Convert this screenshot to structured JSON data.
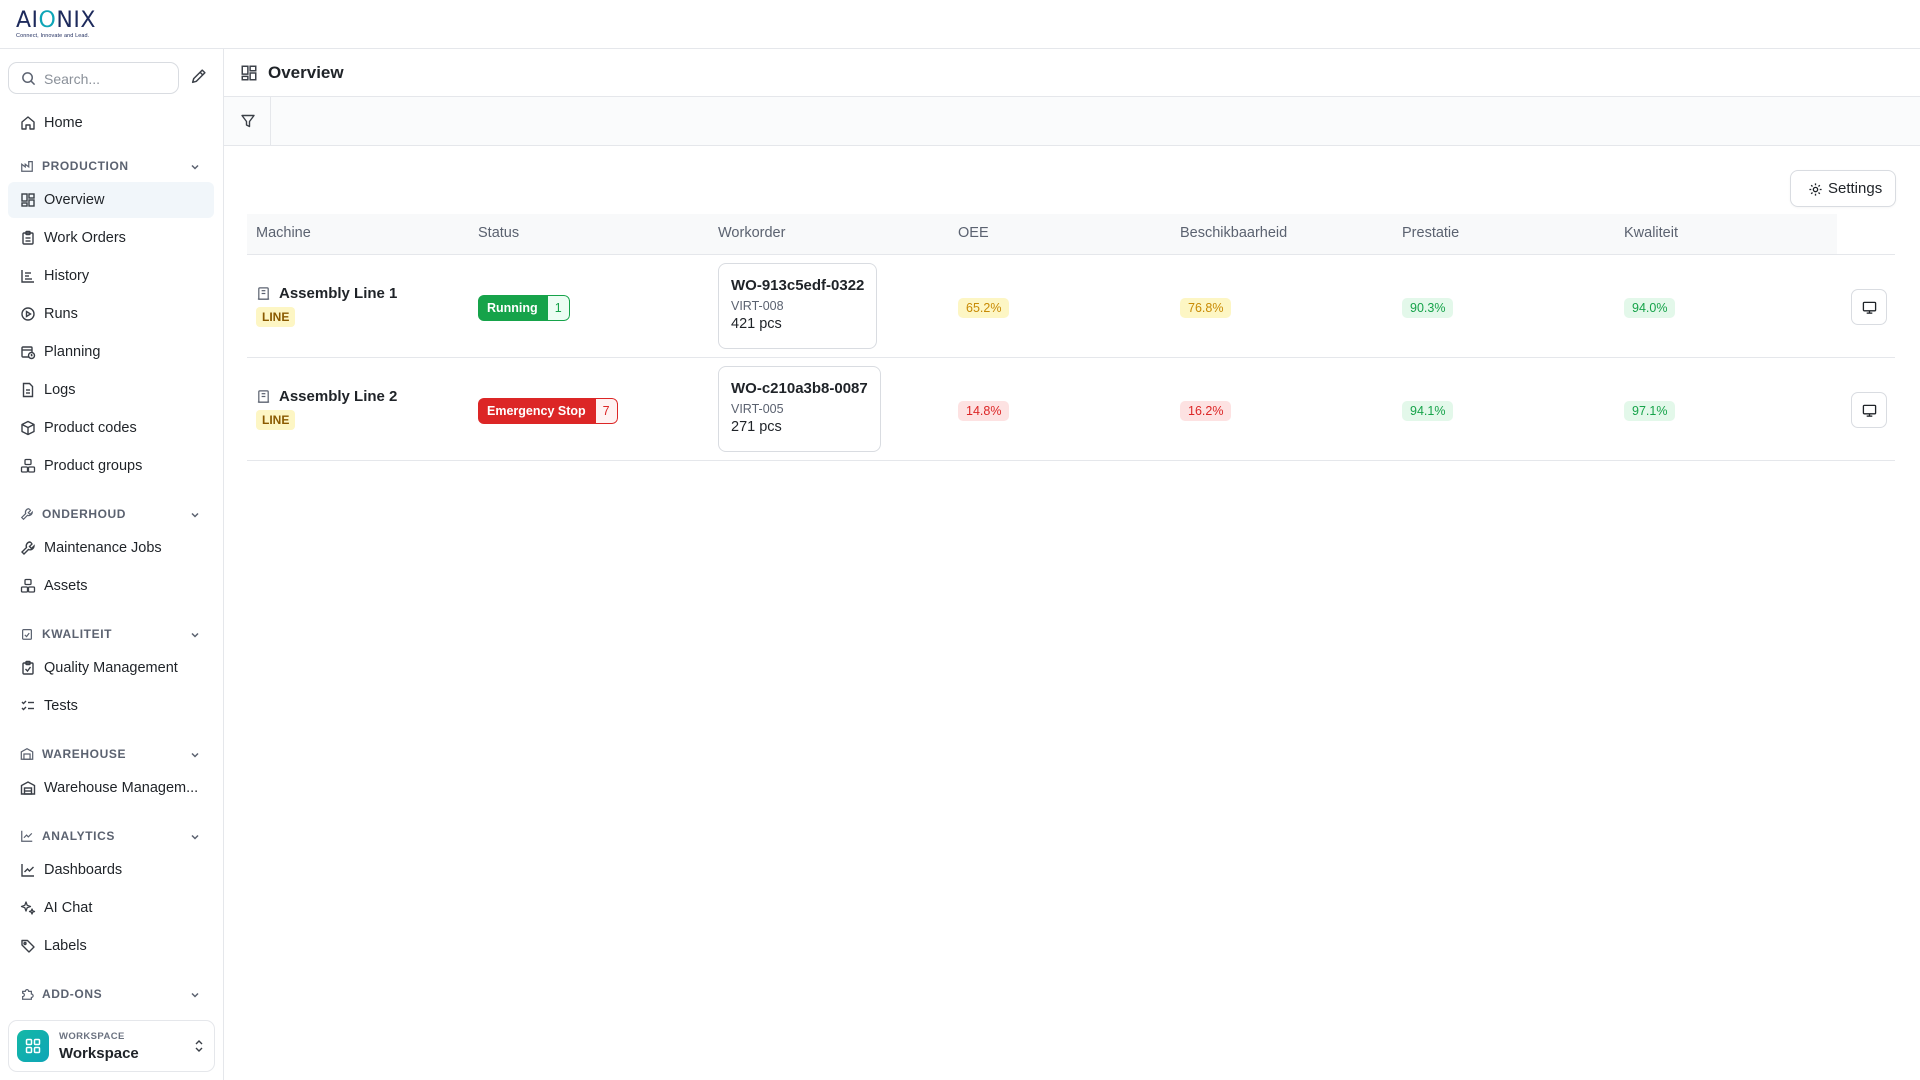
{
  "brand": {
    "logo_text": "AIONIX",
    "logo_tagline": "Connect, Innovate and Lead."
  },
  "search": {
    "placeholder": "Search..."
  },
  "nav": {
    "home": "Home",
    "sections": {
      "production": "PRODUCTION",
      "onderhoud": "ONDERHOUD",
      "kwaliteit": "KWALITEIT",
      "warehouse": "WAREHOUSE",
      "analytics": "ANALYTICS",
      "addons": "ADD-ONS"
    },
    "items": {
      "overview": "Overview",
      "work_orders": "Work Orders",
      "history": "History",
      "runs": "Runs",
      "planning": "Planning",
      "logs": "Logs",
      "product_codes": "Product codes",
      "product_groups": "Product groups",
      "maintenance_jobs": "Maintenance Jobs",
      "assets": "Assets",
      "quality_management": "Quality Management",
      "tests": "Tests",
      "warehouse_management": "Warehouse Managem...",
      "dashboards": "Dashboards",
      "ai_chat": "AI Chat",
      "labels": "Labels"
    }
  },
  "workspace": {
    "caption": "WORKSPACE",
    "name": "Workspace"
  },
  "page": {
    "title": "Overview",
    "settings_label": "Settings"
  },
  "table": {
    "headers": [
      "Machine",
      "Status",
      "Workorder",
      "OEE",
      "Beschikbaarheid",
      "Prestatie",
      "Kwaliteit"
    ],
    "rows": [
      {
        "machine": "Assembly Line 1",
        "type": "LINE",
        "status": "Running",
        "status_count": "1",
        "workorder": {
          "id": "WO-913c5edf-0322",
          "product": "VIRT-008",
          "qty": "421 pcs"
        },
        "oee": "65.2%",
        "beschikbaarheid": "76.8%",
        "prestatie": "90.3%",
        "kwaliteit": "94.0%"
      },
      {
        "machine": "Assembly Line 2",
        "type": "LINE",
        "status": "Emergency Stop",
        "status_count": "7",
        "workorder": {
          "id": "WO-c210a3b8-0087",
          "product": "VIRT-005",
          "qty": "271 pcs"
        },
        "oee": "14.8%",
        "beschikbaarheid": "16.2%",
        "prestatie": "94.1%",
        "kwaliteit": "97.1%"
      }
    ]
  },
  "colors": {
    "running": "#16a34a",
    "emergency": "#dc2626",
    "warning": "#c88a04",
    "accent": "#0ea5b7"
  }
}
